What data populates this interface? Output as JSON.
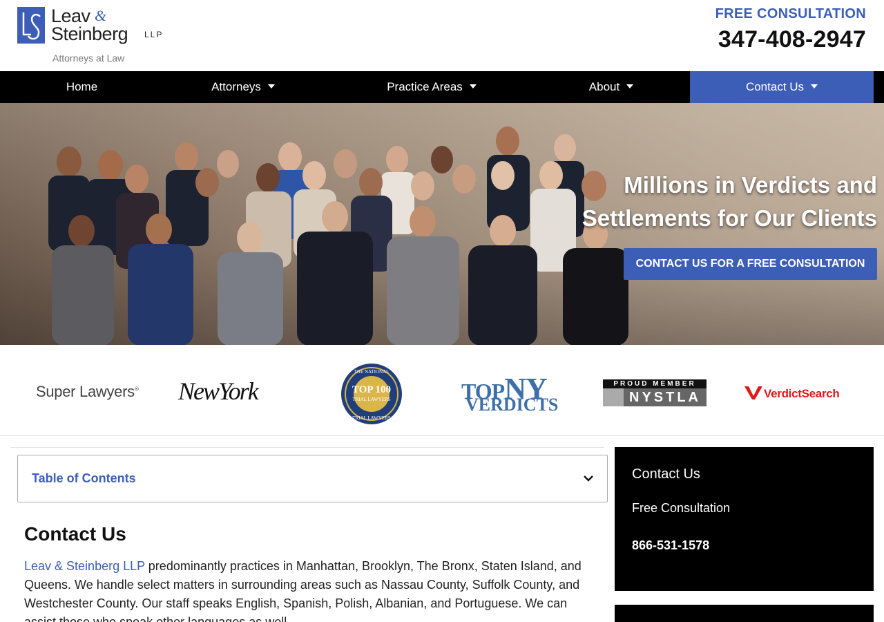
{
  "header": {
    "logo_name_1": "Leav",
    "logo_amp": "&",
    "logo_name_2": "Steinberg",
    "logo_llp": "LLP",
    "logo_tagline": "Attorneys at Law",
    "free_consultation": "FREE CONSULTATION",
    "phone": "347-408-2947"
  },
  "nav": {
    "items": [
      {
        "label": "Home"
      },
      {
        "label": "Attorneys"
      },
      {
        "label": "Practice Areas"
      },
      {
        "label": "About"
      },
      {
        "label": "Contact Us"
      }
    ]
  },
  "hero": {
    "title_line1": "Millions in Verdicts and",
    "title_line2": "Settlements for Our Clients",
    "cta": "CONTACT US FOR A FREE CONSULTATION"
  },
  "badges": {
    "super_lawyers": "Super Lawyers",
    "new_york": "NewYork",
    "top100_top": "THE NATIONAL",
    "top100_main": "TOP 100",
    "top100_sub": "TRIAL LAWYERS",
    "top100_bottom": "TRIAL LAWYERS",
    "top_ny_1": "TOP",
    "top_ny_2": "NY",
    "top_ny_3": "VERDICTS",
    "nystla_top": "PROUD MEMBER",
    "nystla_main": "NYSTLA",
    "verdict_search": "VerdictSearch"
  },
  "toc": {
    "label": "Table of Contents"
  },
  "main": {
    "heading": "Contact Us",
    "para_link": "Leav & Steinberg LLP",
    "para_text": " predominantly practices in Manhattan, Brooklyn, The Bronx, Staten Island, and Queens. We handle select matters in surrounding areas such as Nassau County, Suffolk County, and Westchester County. Our staff speaks English, Spanish, Polish, Albanian, and Portuguese. We can assist those who speak other languages as well."
  },
  "sidebar": {
    "title": "Contact Us",
    "subtitle": "Free Consultation",
    "phone": "866-531-1578"
  },
  "colors": {
    "brand_blue": "#3d5eb7",
    "nav_bg": "#000000",
    "verdict_red": "#e0191b"
  }
}
